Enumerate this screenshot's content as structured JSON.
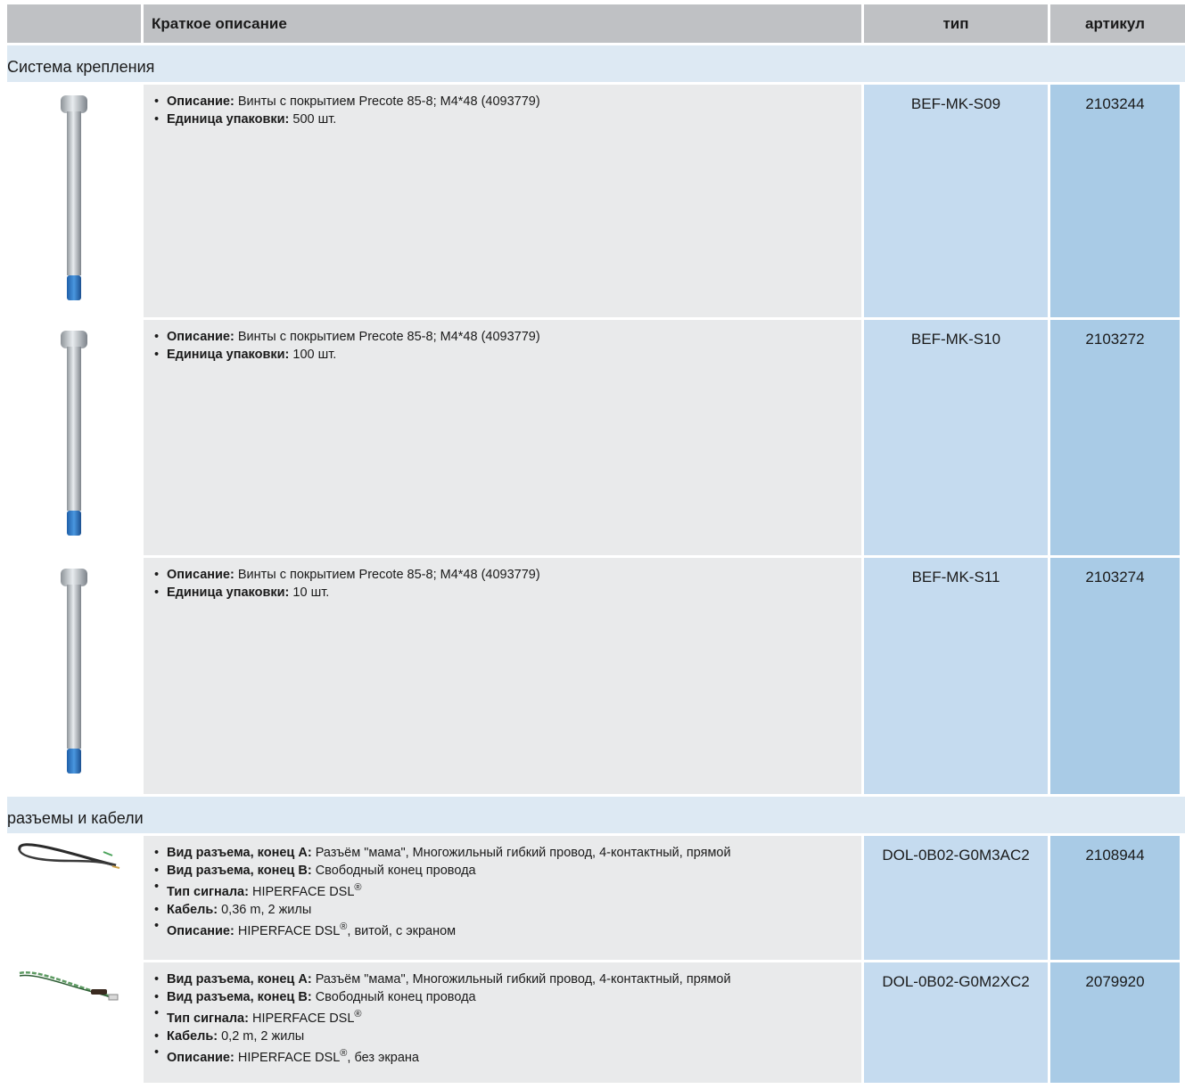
{
  "header": {
    "description": "Краткое описание",
    "type": "тип",
    "article": "артикул"
  },
  "sections": [
    {
      "title": "Система крепления",
      "items": [
        {
          "image": "screw-image",
          "desc_label": "Описание:",
          "desc_value": "Винты с покрытием Precote 85-8; M4*48 (4093779)",
          "pack_label": "Единица упаковки:",
          "pack_value": "500 шт.",
          "type": "BEF-MK-S09",
          "article": "2103244"
        },
        {
          "image": "screw-image",
          "desc_label": "Описание:",
          "desc_value": "Винты с покрытием Precote 85-8; M4*48 (4093779)",
          "pack_label": "Единица упаковки:",
          "pack_value": "100 шт.",
          "type": "BEF-MK-S10",
          "article": "2103272"
        },
        {
          "image": "screw-image",
          "desc_label": "Описание:",
          "desc_value": "Винты с покрытием Precote 85-8; M4*48 (4093779)",
          "pack_label": "Единица упаковки:",
          "pack_value": "10 шт.",
          "type": "BEF-MK-S11",
          "article": "2103274"
        }
      ]
    },
    {
      "title": "разъемы и кабели",
      "items": [
        {
          "image": "cable-image",
          "a_label": "Вид разъема, конец A:",
          "a_value": "Разъём \"мама\", Многожильный гибкий провод, 4-контактный, прямой",
          "b_label": "Вид разъема, конец B:",
          "b_value": "Свободный конец провода",
          "sig_label": "Тип сигнала:",
          "sig_value": "HIPERFACE DSL",
          "sig_sup": "®",
          "cable_label": "Кабель:",
          "cable_value": "0,36 m, 2 жилы",
          "desc_label": "Описание:",
          "desc_value_pre": "HIPERFACE DSL",
          "desc_sup": "®",
          "desc_value_post": ", витой, с экраном",
          "type": "DOL-0B02-G0M3AC2",
          "article": "2108944"
        },
        {
          "image": "cable-image",
          "a_label": "Вид разъема, конец A:",
          "a_value": "Разъём \"мама\", Многожильный гибкий провод, 4-контактный, прямой",
          "b_label": "Вид разъема, конец B:",
          "b_value": "Свободный конец провода",
          "sig_label": "Тип сигнала:",
          "sig_value": "HIPERFACE DSL",
          "sig_sup": "®",
          "cable_label": "Кабель:",
          "cable_value": "0,2 m, 2 жилы",
          "desc_label": "Описание:",
          "desc_value_pre": "HIPERFACE DSL",
          "desc_sup": "®",
          "desc_value_post": ", без экрана",
          "type": "DOL-0B02-G0M2XC2",
          "article": "2079920"
        }
      ]
    }
  ]
}
